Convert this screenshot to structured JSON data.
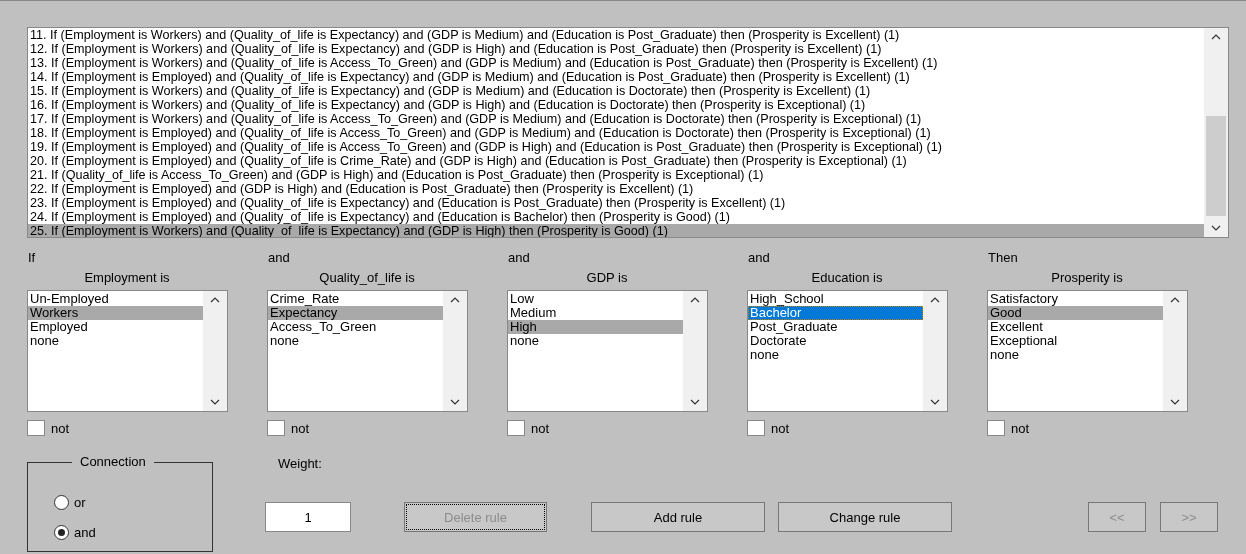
{
  "rules": [
    {
      "text": "11. If (Employment is Workers) and (Quality_of_life is Expectancy) and (GDP is Medium) and (Education is Post_Graduate) then (Prosperity is Excellent) (1)",
      "selected": false
    },
    {
      "text": "12. If (Employment is Workers) and (Quality_of_life is Expectancy) and (GDP is High) and (Education is Post_Graduate) then (Prosperity is Excellent) (1)",
      "selected": false
    },
    {
      "text": "13. If (Employment is Workers) and (Quality_of_life is Access_To_Green) and (GDP is Medium) and (Education is Post_Graduate) then (Prosperity is Excellent) (1)",
      "selected": false
    },
    {
      "text": "14. If (Employment is Employed) and (Quality_of_life is Expectancy) and (GDP is Medium) and (Education is Post_Graduate) then (Prosperity is Excellent) (1)",
      "selected": false
    },
    {
      "text": "15. If (Employment is Workers) and (Quality_of_life is Expectancy) and (GDP is Medium) and (Education is Doctorate) then (Prosperity is Excellent) (1)",
      "selected": false
    },
    {
      "text": "16. If (Employment is Workers) and (Quality_of_life is Expectancy) and (GDP is High) and (Education is Doctorate) then (Prosperity is Exceptional) (1)",
      "selected": false
    },
    {
      "text": "17. If (Employment is Workers) and (Quality_of_life is Access_To_Green) and (GDP is Medium) and (Education is Doctorate) then (Prosperity is Exceptional) (1)",
      "selected": false
    },
    {
      "text": "18. If (Employment is Employed) and (Quality_of_life is Access_To_Green) and (GDP is Medium) and (Education is Doctorate) then (Prosperity is Exceptional) (1)",
      "selected": false
    },
    {
      "text": "19. If (Employment is Employed) and (Quality_of_life is Access_To_Green) and (GDP is High) and (Education is Post_Graduate) then (Prosperity is Exceptional) (1)",
      "selected": false
    },
    {
      "text": "20. If (Employment is Employed) and (Quality_of_life is Crime_Rate) and (GDP is High) and (Education is Post_Graduate) then (Prosperity is Exceptional) (1)",
      "selected": false
    },
    {
      "text": "21. If (Quality_of_life is Access_To_Green) and (GDP is High) and (Education is Post_Graduate) then (Prosperity is Exceptional) (1)",
      "selected": false
    },
    {
      "text": "22. If (Employment is Employed) and (GDP is High) and (Education is Post_Graduate) then (Prosperity is Excellent) (1)",
      "selected": false
    },
    {
      "text": "23. If (Employment is Employed) and (Quality_of_life is Expectancy) and (Education is Post_Graduate) then (Prosperity is Excellent) (1)",
      "selected": false
    },
    {
      "text": "24. If (Employment is Employed) and (Quality_of_life is Expectancy) and (Education is Bachelor) then (Prosperity is Good) (1)",
      "selected": false
    },
    {
      "text": "25. If (Employment is Workers) and (Quality_of_life is Expectancy) and (GDP is High) then (Prosperity is Good) (1)",
      "selected": true
    }
  ],
  "columns": [
    {
      "connector": "If",
      "title": "Employment is",
      "focused": false,
      "not": {
        "label": "not",
        "checked": false
      },
      "options": [
        {
          "label": "Un-Employed",
          "selected": false
        },
        {
          "label": "Workers",
          "selected": true
        },
        {
          "label": "Employed",
          "selected": false
        },
        {
          "label": "none",
          "selected": false
        }
      ]
    },
    {
      "connector": "and",
      "title": "Quality_of_life is",
      "focused": false,
      "not": {
        "label": "not",
        "checked": false
      },
      "options": [
        {
          "label": "Crime_Rate",
          "selected": false
        },
        {
          "label": "Expectancy",
          "selected": true
        },
        {
          "label": "Access_To_Green",
          "selected": false
        },
        {
          "label": "none",
          "selected": false
        }
      ]
    },
    {
      "connector": "and",
      "title": "GDP is",
      "focused": false,
      "not": {
        "label": "not",
        "checked": false
      },
      "options": [
        {
          "label": "Low",
          "selected": false
        },
        {
          "label": "Medium",
          "selected": false
        },
        {
          "label": "High",
          "selected": true
        },
        {
          "label": "none",
          "selected": false
        }
      ]
    },
    {
      "connector": "and",
      "title": "Education is",
      "focused": true,
      "not": {
        "label": "not",
        "checked": false
      },
      "options": [
        {
          "label": "High_School",
          "selected": false
        },
        {
          "label": "Bachelor",
          "selected": true
        },
        {
          "label": "Post_Graduate",
          "selected": false
        },
        {
          "label": "Doctorate",
          "selected": false
        },
        {
          "label": "none",
          "selected": false
        }
      ]
    },
    {
      "connector": "Then",
      "title": "Prosperity is",
      "focused": false,
      "not": {
        "label": "not",
        "checked": false
      },
      "options": [
        {
          "label": "Satisfactory",
          "selected": false
        },
        {
          "label": "Good",
          "selected": true
        },
        {
          "label": "Excellent",
          "selected": false
        },
        {
          "label": "Exceptional",
          "selected": false
        },
        {
          "label": "none",
          "selected": false
        }
      ]
    }
  ],
  "connection": {
    "title": "Connection",
    "options": [
      {
        "label": "or",
        "selected": false
      },
      {
        "label": "and",
        "selected": true
      }
    ]
  },
  "weight": {
    "label": "Weight:",
    "value": "1"
  },
  "buttons": [
    {
      "label": "Delete rule",
      "disabled": true,
      "focused": true,
      "kind": "wide"
    },
    {
      "label": "Add rule",
      "disabled": false,
      "focused": false,
      "kind": "wide"
    },
    {
      "label": "Change rule",
      "disabled": false,
      "focused": false,
      "kind": "wide"
    },
    {
      "label": "<<",
      "disabled": true,
      "focused": false,
      "kind": "nav"
    },
    {
      "label": ">>",
      "disabled": true,
      "focused": false,
      "kind": "nav"
    }
  ]
}
